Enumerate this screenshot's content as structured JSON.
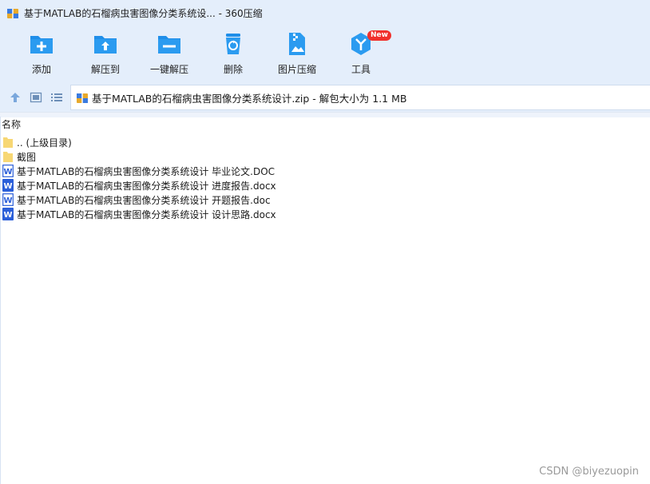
{
  "window": {
    "title": "基于MATLAB的石榴病虫害图像分类系统设... - 360压缩"
  },
  "toolbar": {
    "buttons": [
      {
        "id": "add",
        "label": "添加",
        "icon": "add-folder-icon"
      },
      {
        "id": "extract-to",
        "label": "解压到",
        "icon": "extract-to-folder-icon"
      },
      {
        "id": "one-click-extract",
        "label": "一键解压",
        "icon": "one-click-extract-icon"
      },
      {
        "id": "delete",
        "label": "删除",
        "icon": "recycle-bin-icon"
      },
      {
        "id": "image-compress",
        "label": "图片压缩",
        "icon": "image-compress-icon"
      },
      {
        "id": "tools",
        "label": "工具",
        "icon": "tools-icon",
        "badge": "New"
      }
    ]
  },
  "nav": {
    "path": "基于MATLAB的石榴病虫害图像分类系统设计.zip - 解包大小为 1.1 MB"
  },
  "list": {
    "column_name": "名称",
    "items": [
      {
        "name": ".. (上级目录)",
        "type": "folder"
      },
      {
        "name": "截图",
        "type": "folder"
      },
      {
        "name": "基于MATLAB的石榴病虫害图像分类系统设计 毕业论文.DOC",
        "type": "doc"
      },
      {
        "name": "基于MATLAB的石榴病虫害图像分类系统设计 进度报告.docx",
        "type": "docx"
      },
      {
        "name": "基于MATLAB的石榴病虫害图像分类系统设计 开题报告.doc",
        "type": "doc"
      },
      {
        "name": "基于MATLAB的石榴病虫害图像分类系统设计 设计思路.docx",
        "type": "docx"
      }
    ]
  },
  "watermark": "CSDN @biyezuopin",
  "colors": {
    "accent": "#1f8ee9",
    "chrome": "#e4eefb",
    "badge": "#f0302c",
    "folder": "#f7d774",
    "word": "#2b5fd9"
  }
}
